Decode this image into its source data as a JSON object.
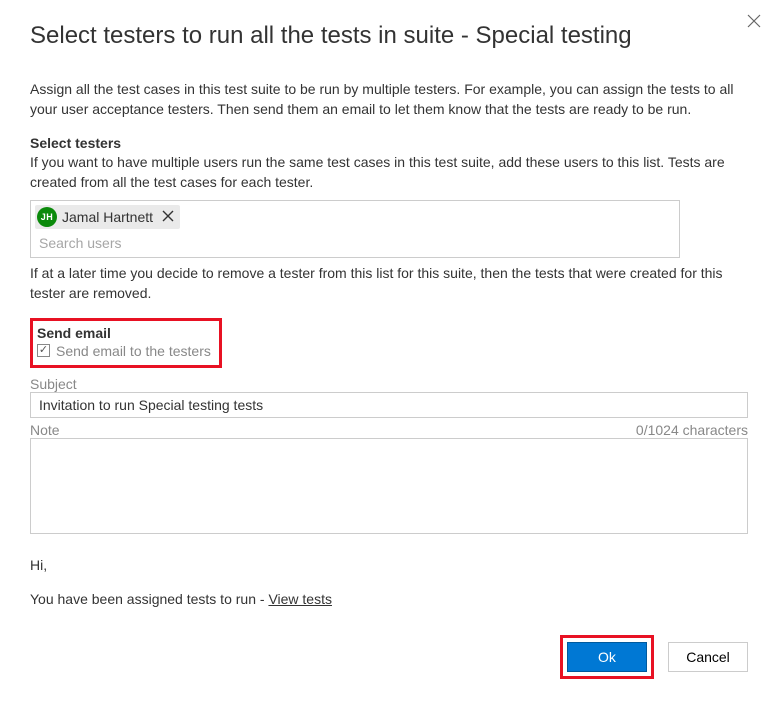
{
  "dialog": {
    "title": "Select testers to run all the tests in suite - Special testing",
    "intro": "Assign all the test cases in this test suite to be run by multiple testers. For example, you can assign the tests to all your user acceptance testers. Then send them an email to let them know that the tests are ready to be run."
  },
  "testers": {
    "section_title": "Select testers",
    "section_desc": "If you want to have multiple users run the same test cases in this test suite, add these users to this list. Tests are created from all the test cases for each tester.",
    "items": [
      {
        "initials": "JH",
        "name": "Jamal Hartnett"
      }
    ],
    "search_placeholder": "Search users",
    "remove_note": "If at a later time you decide to remove a tester from this list for this suite, then the tests that were created for this tester are removed."
  },
  "email": {
    "section_title": "Send email",
    "checkbox_label": "Send email to the testers",
    "checkbox_checked": true,
    "subject_label": "Subject",
    "subject_value": "Invitation to run Special testing tests",
    "note_label": "Note",
    "char_count": "0/1024 characters",
    "note_value": "",
    "preview_greeting": "Hi,",
    "preview_body": "You have been assigned tests to run - ",
    "view_tests_link": "View tests"
  },
  "buttons": {
    "ok": "Ok",
    "cancel": "Cancel"
  }
}
